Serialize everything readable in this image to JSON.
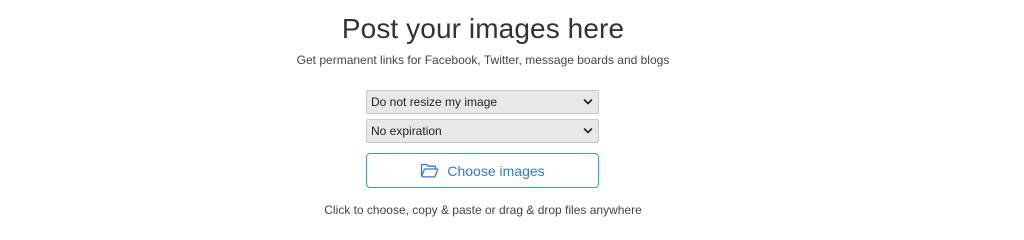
{
  "header": {
    "title": "Post your images here",
    "subtitle": "Get permanent links for Facebook, Twitter, message boards and blogs"
  },
  "form": {
    "resize_select": {
      "selected": "Do not resize my image"
    },
    "expiration_select": {
      "selected": "No expiration"
    },
    "choose_button": {
      "label": "Choose images",
      "icon": "folder-open-icon"
    },
    "hint": "Click to choose, copy & paste or drag & drop files anywhere"
  },
  "colors": {
    "accent": "#2f7bd1",
    "select_bg": "#e8e8e8"
  }
}
